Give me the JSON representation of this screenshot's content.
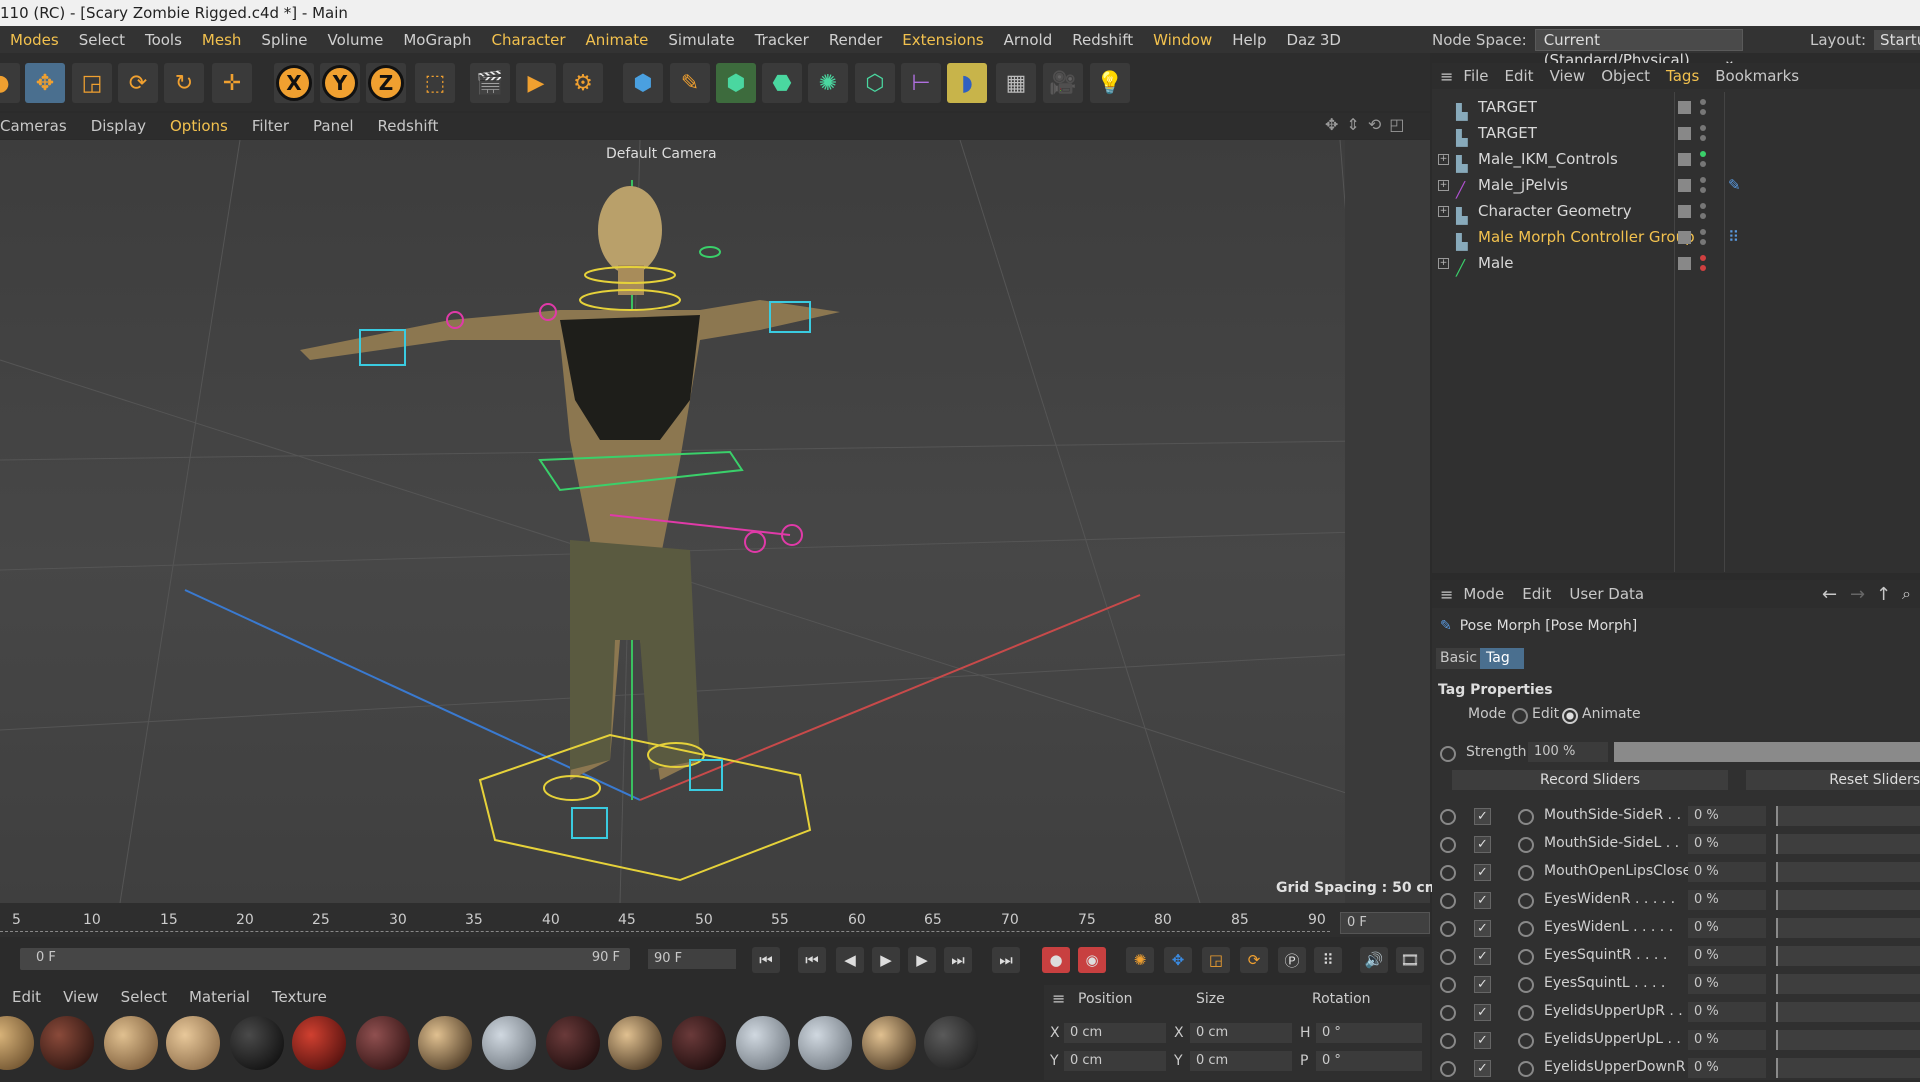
{
  "title_bar": {
    "text": "110 (RC) - [Scary Zombie Rigged.c4d *] - Main"
  },
  "menu": {
    "items": [
      "Modes",
      "Select",
      "Tools",
      "Mesh",
      "Spline",
      "Volume",
      "MoGraph",
      "Character",
      "Animate",
      "Simulate",
      "Tracker",
      "Render",
      "Extensions",
      "Arnold",
      "Redshift",
      "Window",
      "Help",
      "Daz 3D"
    ],
    "node_space_label": "Node Space:",
    "node_space_value": "Current (Standard/Physical)",
    "layout_label": "Layout:",
    "layout_value": "Startup"
  },
  "viewport_menu": {
    "items": [
      "Cameras",
      "Display",
      "Options",
      "Filter",
      "Panel",
      "Redshift"
    ]
  },
  "viewport": {
    "camera_label": "Default Camera",
    "grid_spacing": "Grid Spacing : 50 cm"
  },
  "timeline": {
    "ticks": [
      "5",
      "10",
      "15",
      "20",
      "25",
      "30",
      "35",
      "40",
      "45",
      "50",
      "55",
      "60",
      "65",
      "70",
      "75",
      "80",
      "85",
      "90"
    ],
    "current_frame": "0 F",
    "start_frame": "0 F",
    "end_frame": "90 F",
    "max_frame": "90 F"
  },
  "material_menu": {
    "items": [
      "Edit",
      "View",
      "Select",
      "Material",
      "Texture"
    ]
  },
  "coordinates": {
    "headers": [
      "Position",
      "Size",
      "Rotation"
    ],
    "rows": [
      {
        "axis": "X",
        "position": "0 cm",
        "size_axis": "X",
        "size": "0 cm",
        "rot_axis": "H",
        "rotation": "0 °"
      },
      {
        "axis": "Y",
        "position": "0 cm",
        "size_axis": "Y",
        "size": "0 cm",
        "rot_axis": "P",
        "rotation": "0 °"
      }
    ]
  },
  "object_manager": {
    "menu": [
      "File",
      "Edit",
      "View",
      "Object",
      "Tags",
      "Bookmarks"
    ],
    "objects": [
      {
        "name": "TARGET"
      },
      {
        "name": "TARGET"
      },
      {
        "name": "Male_IKM_Controls"
      },
      {
        "name": "Male_jPelvis"
      },
      {
        "name": "Character Geometry"
      },
      {
        "name": "Male Morph Controller Group"
      },
      {
        "name": "Male"
      }
    ]
  },
  "attribute_manager": {
    "menu": [
      "Mode",
      "Edit",
      "User Data"
    ],
    "object_title": "Pose Morph [Pose Morph]",
    "tabs": [
      "Basic",
      "Tag"
    ],
    "section": "Tag Properties",
    "mode_label": "Mode",
    "mode_options": [
      "Edit",
      "Animate"
    ],
    "strength_label": "Strength",
    "strength_value": "100 %",
    "record_button": "Record Sliders",
    "reset_button": "Reset Sliders",
    "morphs": [
      {
        "name": "MouthSide-SideR . .",
        "value": "0 %"
      },
      {
        "name": "MouthSide-SideL . .",
        "value": "0 %"
      },
      {
        "name": "MouthOpenLipsClose",
        "value": "0 %"
      },
      {
        "name": "EyesWidenR . . . . .",
        "value": "0 %"
      },
      {
        "name": "EyesWidenL . . . . .",
        "value": "0 %"
      },
      {
        "name": "EyesSquintR . . . .",
        "value": "0 %"
      },
      {
        "name": "EyesSquintL . . . .",
        "value": "0 %"
      },
      {
        "name": "EyelidsUpperUpR . .",
        "value": "0 %"
      },
      {
        "name": "EyelidsUpperUpL . .",
        "value": "0 %"
      },
      {
        "name": "EyelidsUpperDownR",
        "value": "0 %"
      }
    ]
  },
  "colors": {
    "accent": "#f2c14e",
    "selection": "#f0a030"
  }
}
